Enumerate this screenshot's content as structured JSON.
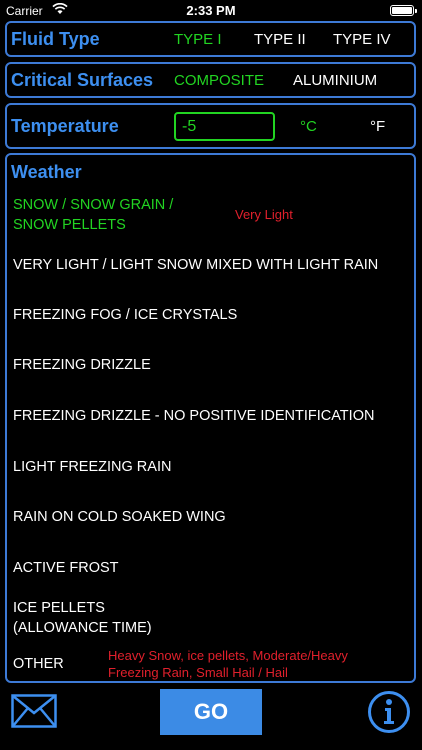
{
  "status_bar": {
    "carrier": "Carrier",
    "time": "2:33 PM"
  },
  "fluid_type": {
    "title": "Fluid Type",
    "options": [
      "TYPE I",
      "TYPE II",
      "TYPE IV"
    ],
    "selected": "TYPE I"
  },
  "critical_surfaces": {
    "title": "Critical Surfaces",
    "options": [
      "COMPOSITE",
      "ALUMINIUM"
    ],
    "selected": "COMPOSITE"
  },
  "temperature": {
    "title": "Temperature",
    "value": "-5",
    "units": [
      "°C",
      "°F"
    ],
    "selected_unit": "°C"
  },
  "weather": {
    "title": "Weather",
    "items": [
      {
        "line1": "SNOW / SNOW GRAIN /",
        "line2": "SNOW PELLETS"
      },
      {
        "line1": "VERY LIGHT / LIGHT SNOW MIXED WITH LIGHT RAIN",
        "line2": ""
      },
      {
        "line1": "FREEZING FOG / ICE CRYSTALS",
        "line2": ""
      },
      {
        "line1": "FREEZING DRIZZLE",
        "line2": ""
      },
      {
        "line1": "FREEZING DRIZZLE - NO POSITIVE IDENTIFICATION",
        "line2": ""
      },
      {
        "line1": "LIGHT FREEZING RAIN",
        "line2": ""
      },
      {
        "line1": "RAIN ON COLD SOAKED WING",
        "line2": ""
      },
      {
        "line1": "ACTIVE FROST",
        "line2": ""
      },
      {
        "line1": "ICE PELLETS",
        "line2": "(ALLOWANCE TIME)"
      },
      {
        "line1": "OTHER",
        "line2": ""
      }
    ],
    "selected_index": 0,
    "snow_intensity": "Very Light",
    "other_note_line1": "Heavy Snow, ice pellets, Moderate/Heavy",
    "other_note_line2": "Freezing Rain, Small Hail / Hail"
  },
  "actions": {
    "go_label": "GO"
  },
  "colors": {
    "accent_blue": "#3d8ff0",
    "border_blue": "#3d7ad6",
    "selected_green": "#22d422",
    "warning_red": "#e0202c",
    "go_button": "#3c8be5"
  },
  "icons": {
    "mail": "envelope-icon",
    "info": "info-icon"
  }
}
